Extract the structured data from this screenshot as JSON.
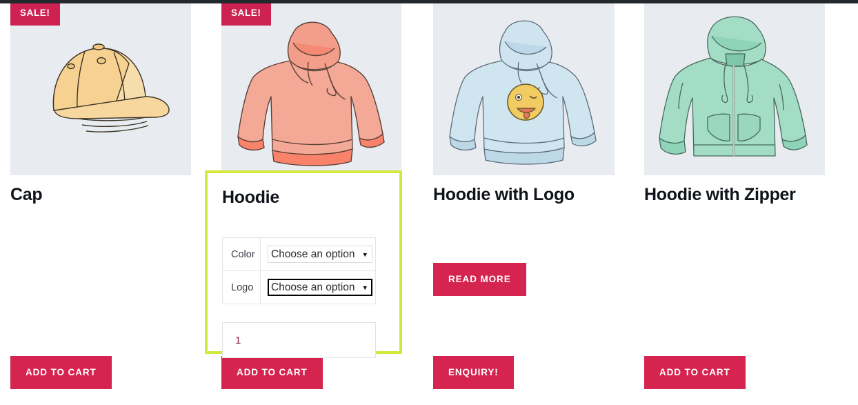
{
  "page": {
    "topbar_color": "#23282d",
    "accent_button_color": "#d4244f",
    "sale_badge_color": "#cc2151",
    "highlight_border_color": "#d2e93c",
    "image_bg_color": "#e8ebef"
  },
  "products": [
    {
      "id": "cap",
      "title": "Cap",
      "badge": "SALE!",
      "has_badge": true,
      "image_name": "cap-illustration",
      "image_color": "#f5d99a",
      "action_label": "ADD TO CART",
      "action_name": "add-to-cart-button"
    },
    {
      "id": "hoodie",
      "title": "Hoodie",
      "badge": "SALE!",
      "has_badge": true,
      "image_name": "hoodie-illustration",
      "image_color": "#f4a48f",
      "action_label": "ADD TO CART",
      "action_name": "add-to-cart-button",
      "selected": true,
      "variations": [
        {
          "label": "Color",
          "value": "Choose an option",
          "focused": false
        },
        {
          "label": "Logo",
          "value": "Choose an option",
          "focused": true
        }
      ],
      "quantity": "1",
      "quantity_placeholder": "1"
    },
    {
      "id": "hoodie-with-logo",
      "title": "Hoodie with Logo",
      "badge": "",
      "has_badge": false,
      "image_name": "hoodie-with-logo-illustration",
      "image_color": "#c3dced",
      "secondary_label": "READ MORE",
      "secondary_name": "read-more-button",
      "action_label": "ENQUIRY!",
      "action_name": "enquiry-button"
    },
    {
      "id": "hoodie-with-zipper",
      "title": "Hoodie with Zipper",
      "badge": "",
      "has_badge": false,
      "image_name": "hoodie-with-zipper-illustration",
      "image_color": "#9fdcc3",
      "action_label": "ADD TO CART",
      "action_name": "add-to-cart-button"
    }
  ]
}
